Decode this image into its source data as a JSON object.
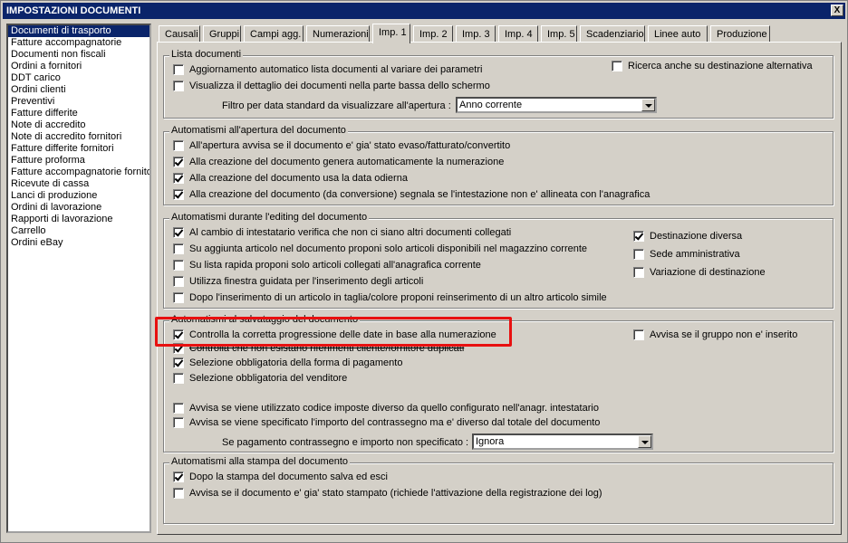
{
  "window": {
    "title": "IMPOSTAZIONI DOCUMENTI",
    "close_label": "X"
  },
  "doc_list": [
    "Documenti di trasporto",
    "Fatture accompagnatorie",
    "Documenti non fiscali",
    "Ordini a fornitori",
    "DDT carico",
    "Ordini clienti",
    "Preventivi",
    "Fatture differite",
    "Note di accredito",
    "Note di accredito fornitori",
    "Fatture differite fornitori",
    "Fatture proforma",
    "Fatture accompagnatorie fornito",
    "Ricevute di cassa",
    "Lanci di produzione",
    "Ordini di lavorazione",
    "Rapporti di lavorazione",
    "Carrello",
    "Ordini eBay"
  ],
  "tabs": [
    "Causali",
    "Gruppi",
    "Campi agg.",
    "Numerazioni",
    "Imp. 1",
    "Imp. 2",
    "Imp. 3",
    "Imp. 4",
    "Imp. 5",
    "Scadenziario",
    "Linee auto",
    "Produzione"
  ],
  "active_tab": "Imp. 1",
  "groups": {
    "lista": {
      "title": "Lista documenti",
      "items": [
        {
          "label": "Aggiornamento automatico lista documenti al variare dei parametri",
          "checked": false
        },
        {
          "label": "Visualizza il dettaglio dei documenti nella parte bassa dello schermo",
          "checked": false
        },
        {
          "label": "Ricerca anche su destinazione alternativa",
          "checked": false
        }
      ],
      "filter_label": "Filtro per data standard da visualizzare all'apertura :",
      "filter_value": "Anno corrente"
    },
    "apertura": {
      "title": "Automatismi all'apertura del documento",
      "items": [
        {
          "label": "All'apertura avvisa se il documento e' gia' stato evaso/fatturato/convertito",
          "checked": false
        },
        {
          "label": "Alla creazione del documento genera automaticamente la numerazione",
          "checked": true
        },
        {
          "label": "Alla creazione del documento usa la data odierna",
          "checked": true
        },
        {
          "label": "Alla creazione del documento (da conversione) segnala se l'intestazione non e' allineata con l'anagrafica",
          "checked": true
        }
      ]
    },
    "editing": {
      "title": "Automatismi durante l'editing del documento",
      "items": [
        {
          "label": "Al cambio di intestatario verifica che non ci siano altri documenti collegati",
          "checked": true
        },
        {
          "label": "Su aggiunta articolo nel documento proponi solo articoli disponibili nel magazzino corrente",
          "checked": false
        },
        {
          "label": "Su lista rapida proponi solo articoli collegati all'anagrafica corrente",
          "checked": false
        },
        {
          "label": "Utilizza finestra guidata per l'inserimento degli articoli",
          "checked": false
        },
        {
          "label": "Dopo l'inserimento di un articolo in taglia/colore proponi reinserimento di un altro articolo simile",
          "checked": false
        }
      ],
      "right_items": [
        {
          "label": "Destinazione diversa",
          "checked": true
        },
        {
          "label": "Sede amministrativa",
          "checked": false
        },
        {
          "label": "Variazione di destinazione",
          "checked": false
        }
      ]
    },
    "salvataggio": {
      "title": "Automatismi al salvataggio del documento",
      "items": [
        {
          "label": "Controlla la corretta progressione delle date in base alla numerazione",
          "checked": true
        },
        {
          "label": "Controlla che non esistano riferimenti cliente/fornitore duplicati",
          "checked": true
        },
        {
          "label": "Selezione obbligatoria della forma di pagamento",
          "checked": true
        },
        {
          "label": "Selezione obbligatoria del venditore",
          "checked": false
        },
        {
          "label": "Avvisa se viene utilizzato codice imposte diverso da quello configurato nell'anagr. intestatario",
          "checked": false
        },
        {
          "label": "Avvisa se viene specificato l'importo del contrassegno ma e' diverso dal totale del documento",
          "checked": false
        }
      ],
      "right_item": {
        "label": "Avvisa se il gruppo non e' inserito",
        "checked": false
      },
      "contrassegno_label": "Se pagamento contrassegno e importo non specificato :",
      "contrassegno_value": "Ignora"
    },
    "stampa": {
      "title": "Automatismi alla stampa del documento",
      "items": [
        {
          "label": "Dopo la stampa del documento salva ed esci",
          "checked": true
        },
        {
          "label": "Avvisa se il documento e' gia' stato stampato (richiede l'attivazione della registrazione dei log)",
          "checked": false
        }
      ]
    }
  },
  "colors": {
    "titlebar": "#0a246a",
    "highlight": "#e81010",
    "face": "#d4d0c8"
  }
}
